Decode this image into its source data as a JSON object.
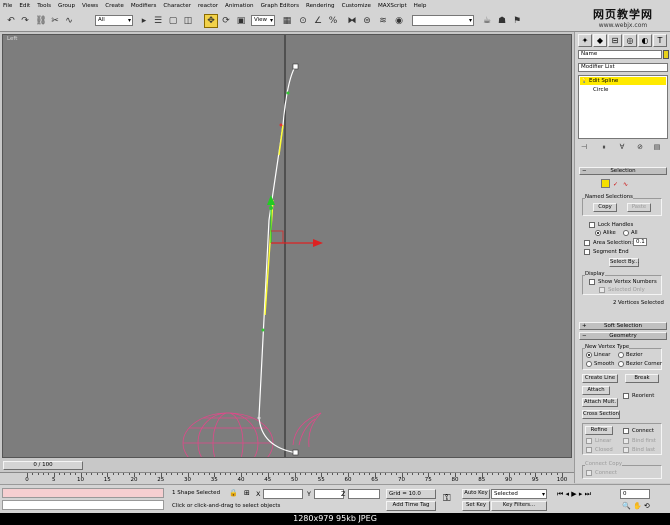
{
  "menu": [
    "File",
    "Edit",
    "Tools",
    "Group",
    "Views",
    "Create",
    "Modifiers",
    "Character",
    "reactor",
    "Animation",
    "Graph Editors",
    "Rendering",
    "Customize",
    "MAXScript",
    "Help"
  ],
  "watermark": {
    "title": "网页教学网",
    "url": "www.webjx.com"
  },
  "toolbar": {
    "filter": "All",
    "coord": "View"
  },
  "viewport": {
    "label": "Left"
  },
  "panel": {
    "name_field": "Name",
    "modifier_list": "Modifier List",
    "stack": [
      "Edit Spline",
      "Circle"
    ]
  },
  "selection": {
    "header": "Selection",
    "named_selections": "Named Selections",
    "copy": "Copy",
    "paste": "Paste",
    "lock_handles": "Lock Handles",
    "alike": "Alike",
    "all": "All",
    "area_selection": "Area Selection:",
    "area_value": "0.1",
    "segment_end": "Segment End",
    "select_by": "Select By...",
    "display": "Display",
    "show_vertex_numbers": "Show Vertex Numbers",
    "selected_only": "Selected Only",
    "status": "2 Vertices Selected"
  },
  "soft_selection": {
    "header": "Soft Selection"
  },
  "geometry": {
    "header": "Geometry",
    "new_vertex_type": "New Vertex Type",
    "linear": "Linear",
    "bezier": "Bezier",
    "smooth": "Smooth",
    "bezier_corner": "Bezier Corner",
    "create_line": "Create Line",
    "break": "Break",
    "attach": "Attach",
    "reorient": "Reorient",
    "attach_mult": "Attach Mult.",
    "cross_section": "Cross Section",
    "refine": "Refine",
    "connect": "Connect",
    "linear2": "Linear",
    "bind_first": "Bind first",
    "closed": "Closed",
    "bind_last": "Bind last",
    "connect_copy": "Connect Copy",
    "connect2": "Connect"
  },
  "timeline": {
    "slider": "0 / 100",
    "ticks": [
      "0",
      "5",
      "10",
      "15",
      "20",
      "25",
      "30",
      "35",
      "40",
      "45",
      "50",
      "55",
      "60",
      "65",
      "70",
      "75",
      "80",
      "85",
      "90",
      "95",
      "100"
    ]
  },
  "status": {
    "shape_selected": "1 Shape Selected",
    "prompt": "Click or click-and-drag to select objects",
    "x_label": "X",
    "y_label": "Y",
    "z_label": "Z",
    "grid": "Grid = 10.0",
    "add_time_tag": "Add Time Tag",
    "auto_key": "Auto Key",
    "selected": "Selected",
    "set_key": "Set Key",
    "key_filters": "Key Filters...",
    "frame": "0"
  },
  "caption": "1280x979  95kb  JPEG"
}
